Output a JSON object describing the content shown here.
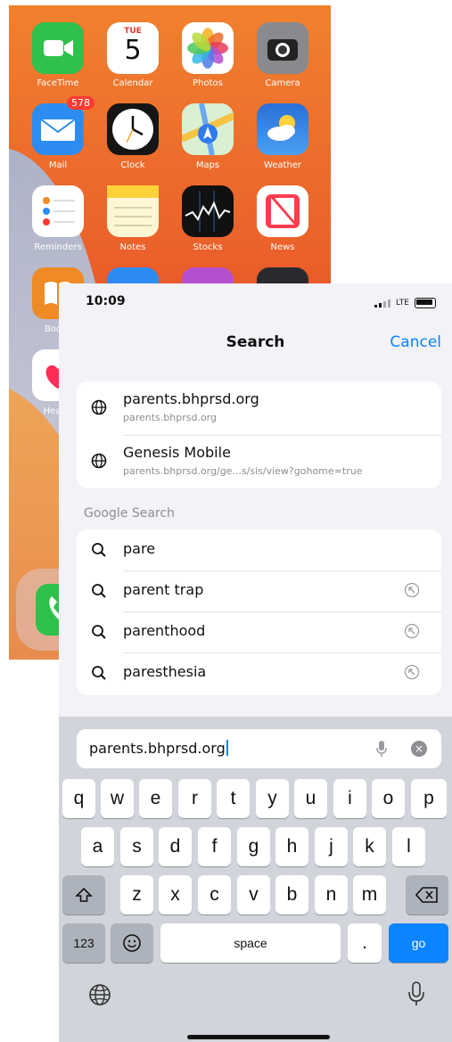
{
  "home": {
    "apps": [
      {
        "label": "FaceTime",
        "color": "#2fc14b"
      },
      {
        "label": "Calendar",
        "color": "#ffffff",
        "day": "TUE",
        "date": "5"
      },
      {
        "label": "Photos",
        "color": "#ffffff"
      },
      {
        "label": "Camera",
        "color": "#7a7a7e"
      },
      {
        "label": "Mail",
        "color": "#2d8cf2",
        "badge": "578"
      },
      {
        "label": "Clock",
        "color": "#151515"
      },
      {
        "label": "Maps",
        "color": "#d9f0d2"
      },
      {
        "label": "Weather",
        "color": "#2e7fe0"
      },
      {
        "label": "Reminders",
        "color": "#ffffff"
      },
      {
        "label": "Notes",
        "color": "#fff7d4"
      },
      {
        "label": "Stocks",
        "color": "#111111"
      },
      {
        "label": "News",
        "color": "#ffffff"
      },
      {
        "label": "Books",
        "color": "#f08a24"
      },
      {
        "label": "Health",
        "color": "#ffffff"
      }
    ]
  },
  "status": {
    "time": "10:09",
    "network": "LTE"
  },
  "nav": {
    "title": "Search",
    "cancel": "Cancel"
  },
  "sites": [
    {
      "title": "parents.bhprsd.org",
      "url": "parents.bhprsd.org"
    },
    {
      "title": "Genesis Mobile",
      "url": "parents.bhprsd.org/ge...s/sis/view?gohome=true"
    }
  ],
  "google_label": "Google Search",
  "suggestions": [
    "pare",
    "parent trap",
    "parenthood",
    "paresthesia"
  ],
  "url_input": {
    "value": "parents.bhprsd.org"
  },
  "keyboard": {
    "row1": [
      "q",
      "w",
      "e",
      "r",
      "t",
      "y",
      "u",
      "i",
      "o",
      "p"
    ],
    "row2": [
      "a",
      "s",
      "d",
      "f",
      "g",
      "h",
      "j",
      "k",
      "l"
    ],
    "row3": [
      "z",
      "x",
      "c",
      "v",
      "b",
      "n",
      "m"
    ],
    "numbers": "123",
    "space": "space",
    "period": ".",
    "go": "go"
  },
  "colors": {
    "accent": "#0a84ff",
    "sheet_bg": "#f2f2f7",
    "keyboard_bg": "#d1d4db"
  }
}
